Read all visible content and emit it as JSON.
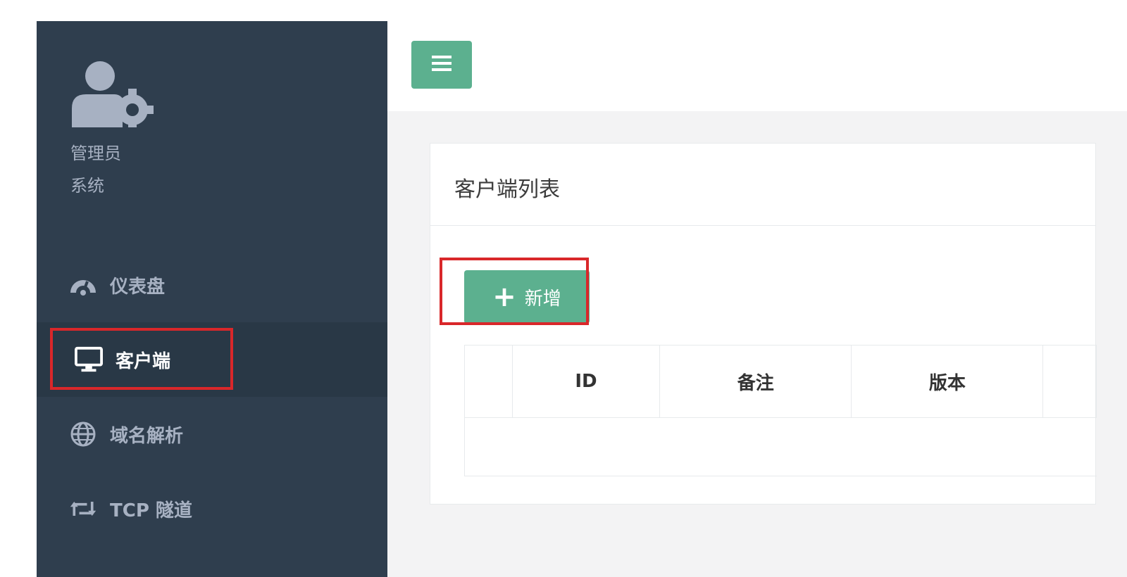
{
  "profile": {
    "name": "管理员",
    "role": "系统",
    "icon": "user-gear-icon"
  },
  "sidebar": {
    "items": [
      {
        "label": "仪表盘",
        "icon": "dashboard-icon",
        "active": false
      },
      {
        "label": "客户端",
        "icon": "desktop-icon",
        "active": true
      },
      {
        "label": "域名解析",
        "icon": "globe-icon",
        "active": false
      },
      {
        "label": "TCP 隧道",
        "icon": "retweet-icon",
        "active": false
      }
    ]
  },
  "topbar": {
    "menu_icon": "hamburger-icon"
  },
  "panel": {
    "title": "客户端列表",
    "add_label": "新增",
    "table": {
      "columns": [
        "",
        "ID",
        "备注",
        "版本",
        ""
      ]
    }
  },
  "colors": {
    "sidebar_bg": "#2f3e4e",
    "sidebar_active_bg": "#293846",
    "accent": "#5cb08f",
    "highlight": "#d9272a"
  }
}
